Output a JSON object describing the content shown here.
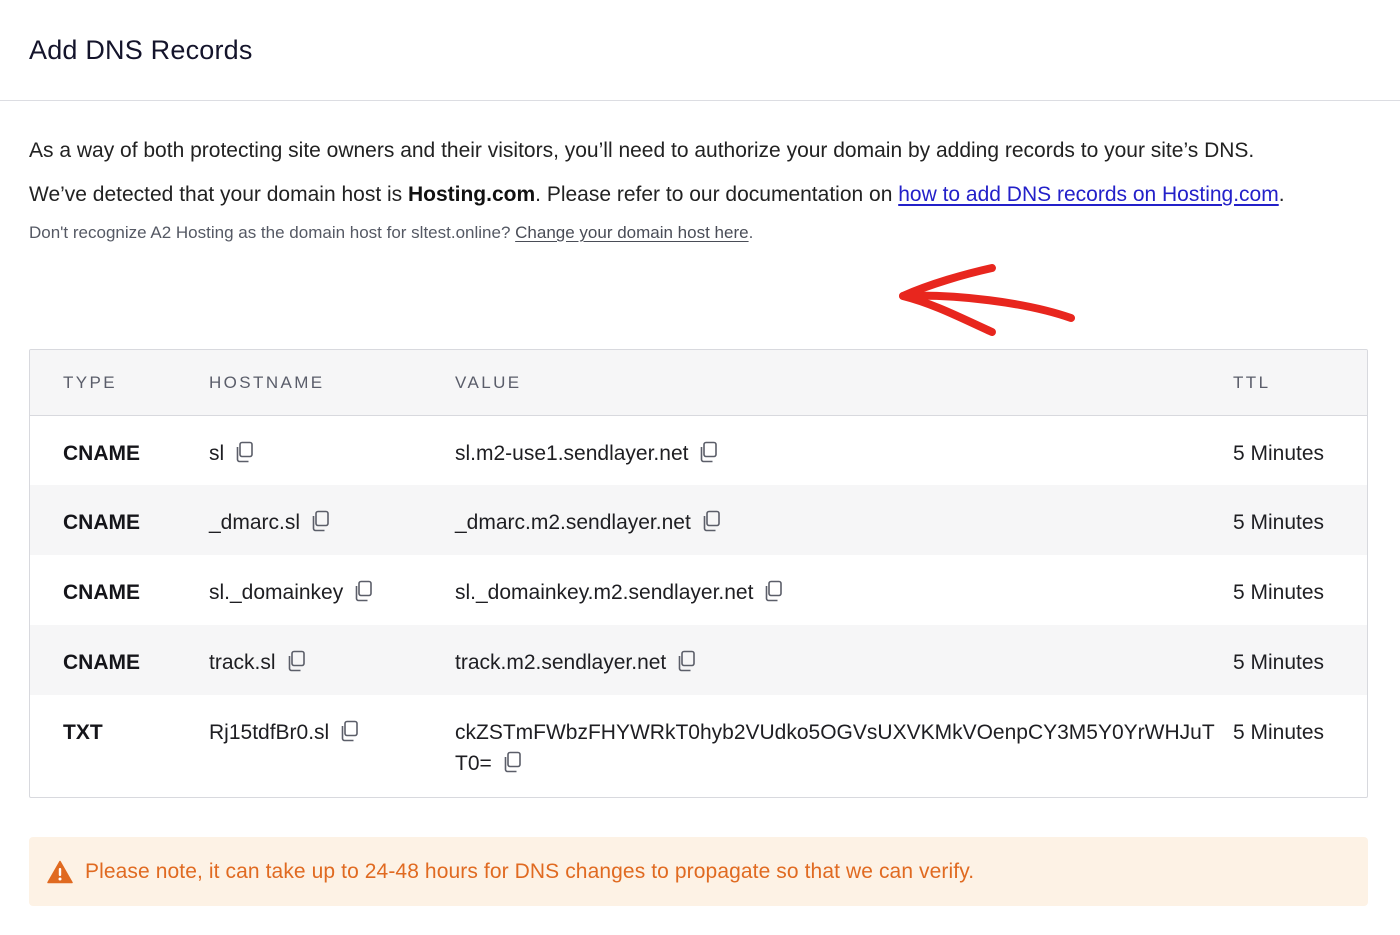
{
  "header": {
    "title": "Add DNS Records"
  },
  "intro": "As a way of both protecting site owners and their visitors, you’ll need to authorize your domain by adding records to your site’s DNS.",
  "host_line": {
    "prefix": "We’ve detected that your domain host is ",
    "host": "Hosting.com",
    "middle": ". Please refer to our documentation on ",
    "link": "how to add DNS records on Hosting.com",
    "suffix": "."
  },
  "note_line": {
    "prefix": "Don't recognize A2 Hosting as the domain host for sltest.online? ",
    "link": "Change your domain host here",
    "suffix": "."
  },
  "table": {
    "headers": [
      "TYPE",
      "HOSTNAME",
      "VALUE",
      "TTL"
    ],
    "rows": [
      {
        "type": "CNAME",
        "hostname": "sl",
        "value": "sl.m2-use1.sendlayer.net",
        "ttl": "5 Minutes"
      },
      {
        "type": "CNAME",
        "hostname": "_dmarc.sl",
        "value": "_dmarc.m2.sendlayer.net",
        "ttl": "5 Minutes"
      },
      {
        "type": "CNAME",
        "hostname": "sl._domainkey",
        "value": "sl._domainkey.m2.sendlayer.net",
        "ttl": "5 Minutes"
      },
      {
        "type": "CNAME",
        "hostname": "track.sl",
        "value": "track.m2.sendlayer.net",
        "ttl": "5 Minutes"
      },
      {
        "type": "TXT",
        "hostname": "Rj15tdfBr0.sl",
        "value": "ckZSTmFWbzFHYWRkT0hyb2VUdko5OGVsUXVKMkVOenpCY3M5Y0YrWHJuTT0=",
        "ttl": "5 Minutes"
      }
    ]
  },
  "alert": {
    "text": "Please note, it can take up to 24-48 hours for DNS changes to propagate so that we can verify."
  },
  "icons": {
    "copy": "copy-icon",
    "warning": "warning-icon",
    "annotation": "red-arrow-annotation"
  },
  "colors": {
    "link": "#2320c9",
    "alert_text": "#e06a21",
    "alert_bg": "#fdf2e5",
    "annotation": "#e8261e"
  }
}
